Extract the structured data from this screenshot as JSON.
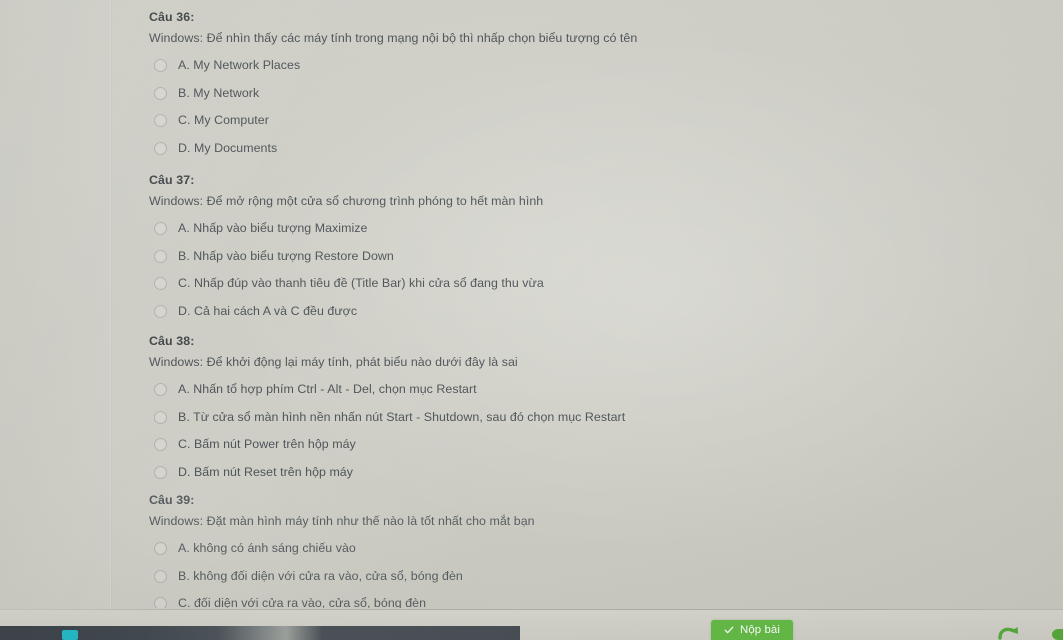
{
  "questions": [
    {
      "id": "q36",
      "title": "Câu 36:",
      "text": "Windows: Để nhìn thấy các máy tính trong mạng nội bộ thì nhấp chọn biểu tượng có tên",
      "options": [
        "A. My Network Places",
        "B. My Network",
        "C. My Computer",
        "D. My Documents"
      ]
    },
    {
      "id": "q37",
      "title": "Câu 37:",
      "text": "Windows: Để mở rộng một cửa sổ chương trình phóng to hết màn hình",
      "options": [
        "A. Nhấp vào biểu tượng Maximize",
        "B. Nhấp vào biểu tượng Restore Down",
        "C. Nhấp đúp vào thanh tiêu đề (Title Bar) khi cửa sổ đang thu vừa",
        "D. Cả hai cách A và C đều được"
      ]
    },
    {
      "id": "q38",
      "title": "Câu 38:",
      "text": "Windows: Để khởi động lại máy tính, phát biểu nào dưới đây là sai",
      "options": [
        "A. Nhấn tổ hợp phím Ctrl - Alt - Del, chọn mục Restart",
        "B. Từ cửa sổ màn hình nền nhấn nút Start - Shutdown, sau đó chọn mục Restart",
        "C. Bấm nút Power trên hộp máy",
        "D. Bấm nút Reset trên hộp máy"
      ]
    },
    {
      "id": "q39",
      "title": "Câu 39:",
      "text": "Windows: Đặt màn hình máy tính như thế nào là tốt nhất cho mắt bạn",
      "options": [
        "A. không có ánh sáng chiếu vào",
        "B. không đối diện với cửa ra vào, cửa sổ, bóng đèn",
        "C. đối diện với cửa ra vào, cửa sổ, bóng đèn"
      ]
    }
  ],
  "bottom_bar": {
    "submit_label": "Nộp bài",
    "submit_icon": "check-icon",
    "submit_color": "#64bb46",
    "redo_icon": "redo-arrow-icon",
    "redo_color": "#57ab3c"
  }
}
